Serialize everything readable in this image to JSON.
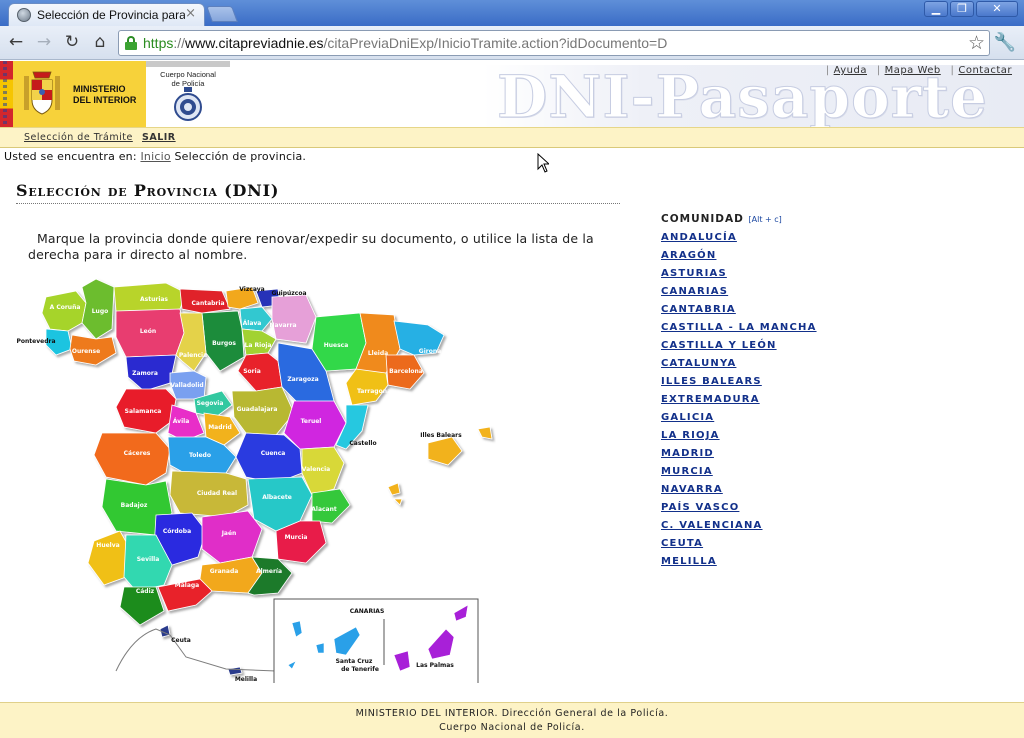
{
  "browser": {
    "tab_title": "Selección de Provincia para Re",
    "tab_close": "×",
    "window_buttons": [
      "▁",
      "❐",
      "✕"
    ],
    "url_scheme": "https",
    "url_sep": "://",
    "url_host": "www.citapreviadnie.es",
    "url_path": "/citaPreviaDniExp/InicioTramite.action?idDocumento=D"
  },
  "header": {
    "ministry_line1": "MINISTERIO",
    "ministry_line2": "DEL INTERIOR",
    "police_line1": "Cuerpo Nacional",
    "police_line2": "de Policía",
    "wordmark": "DNI-Pasaporte",
    "links": [
      "Ayuda",
      "Mapa Web",
      "Contactar"
    ]
  },
  "subnav": {
    "seleccion": "Selección de Trámite",
    "salir": "SALIR"
  },
  "breadcrumb": {
    "prefix": "Usted se encuentra en:",
    "home": "Inicio",
    "current": "Selección de provincia."
  },
  "main": {
    "title": "Selección de Provincia (DNI)",
    "intro": "Marque la provincia donde quiere renovar/expedir su documento, o utilice la lista de la derecha para ir directo al nombre."
  },
  "map": {
    "labels": {
      "acoruna": "A Coruña",
      "lugo": "Lugo",
      "asturias": "Asturias",
      "cantabria": "Cantabria",
      "vizcaya": "Vizcaya",
      "guipuzcoa": "Guipúzcoa",
      "pontevedra": "Pontevedra",
      "ourense": "Ourense",
      "leon": "León",
      "alava": "Álava",
      "navarra": "Navarra",
      "burgos": "Burgos",
      "palencia": "Palencia",
      "larioja": "La Rioja",
      "huesca": "Huesca",
      "lleida": "Lleida",
      "girona": "Girona",
      "zamora": "Zamora",
      "valladolid": "Valladolid",
      "soria": "Soria",
      "zaragoza": "Zaragoza",
      "barcelona": "Barcelona",
      "tarragona": "Tarragona",
      "segovia": "Segovia",
      "salamanca": "Salamanca",
      "avila": "Ávila",
      "guadalajara": "Guadalajara",
      "madrid": "Madrid",
      "teruel": "Teruel",
      "castello": "Castello",
      "illesbalears": "Illes Balears",
      "caceres": "Cáceres",
      "toledo": "Toledo",
      "cuenca": "Cuenca",
      "valencia": "Valencia",
      "badajoz": "Badajoz",
      "ciudadreal": "Ciudad Real",
      "albacete": "Albacete",
      "alacant": "Alacant",
      "cordoba": "Córdoba",
      "jaen": "Jaén",
      "murcia": "Murcia",
      "huelva": "Huelva",
      "sevilla": "Sevilla",
      "granada": "Granada",
      "almeria": "Almería",
      "cadiz": "Cádiz",
      "malaga": "Málaga",
      "ceuta": "Ceuta",
      "melilla": "Melilla",
      "canarias": "CANARIAS",
      "santacruz1": "Santa Cruz",
      "santacruz2": "de Tenerife",
      "laspalmas": "Las Palmas"
    }
  },
  "list": {
    "title": "COMUNIDAD",
    "hint": "[Alt + c]",
    "items": [
      "ANDALUCÍA",
      "ARAGÓN",
      "ASTURIAS",
      "CANARIAS",
      "CANTABRIA",
      "CASTILLA - LA MANCHA",
      "CASTILLA Y LEÓN",
      "CATALUNYA",
      "ILLES BALEARS",
      "EXTREMADURA",
      "GALICIA",
      "LA RIOJA",
      "MADRID",
      "MURCIA",
      "NAVARRA",
      "PAÍS VASCO",
      "C. VALENCIANA",
      "CEUTA",
      "MELILLA"
    ]
  },
  "footer": {
    "line1": "MINISTERIO DEL INTERIOR. Dirección General de la Policía.",
    "line2": "Cuerpo Nacional de Policía."
  }
}
